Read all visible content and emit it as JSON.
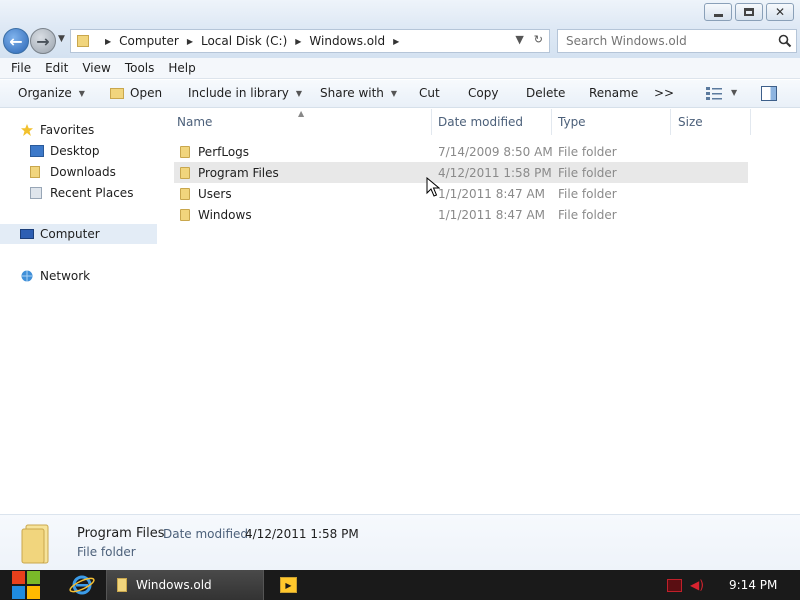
{
  "address_bar": {
    "breadcrumbs": [
      "Computer",
      "Local Disk (C:)",
      "Windows.old"
    ]
  },
  "search": {
    "placeholder": "Search Windows.old"
  },
  "menu": [
    "File",
    "Edit",
    "View",
    "Tools",
    "Help"
  ],
  "toolbar": {
    "organize": "Organize",
    "open": "Open",
    "include_in_library": "Include in library",
    "share_with": "Share with",
    "cut": "Cut",
    "copy": "Copy",
    "delete": "Delete",
    "rename": "Rename",
    "more": ">>"
  },
  "nav": {
    "favorites": "Favorites",
    "desktop": "Desktop",
    "downloads": "Downloads",
    "recent_places": "Recent Places",
    "computer": "Computer",
    "network": "Network"
  },
  "columns": {
    "name": "Name",
    "date_modified": "Date modified",
    "type": "Type",
    "size": "Size"
  },
  "files": [
    {
      "name": "PerfLogs",
      "date": "7/14/2009 8:50 AM",
      "type": "File folder"
    },
    {
      "name": "Program Files",
      "date": "4/12/2011 1:58 PM",
      "type": "File folder"
    },
    {
      "name": "Users",
      "date": "1/1/2011 8:47 AM",
      "type": "File folder"
    },
    {
      "name": "Windows",
      "date": "1/1/2011 8:47 AM",
      "type": "File folder"
    }
  ],
  "details": {
    "name": "Program Files",
    "date_label": "Date modified:",
    "date_value": "4/12/2011 1:58 PM",
    "type": "File folder"
  },
  "taskbar": {
    "window_label": "Windows.old",
    "clock": "9:14 PM"
  },
  "colors": {
    "accent": "#2b66b5",
    "folder": "#f1d57d",
    "taskbar": "#1a1a1a"
  }
}
